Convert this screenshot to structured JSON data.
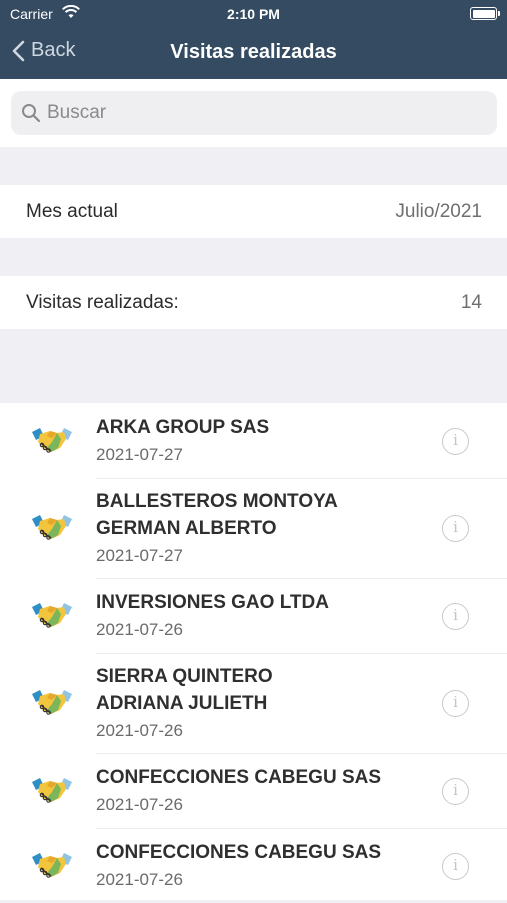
{
  "status_bar": {
    "carrier": "Carrier",
    "time": "2:10 PM"
  },
  "nav": {
    "back_label": "Back",
    "title": "Visitas realizadas"
  },
  "search": {
    "placeholder": "Buscar"
  },
  "summary": [
    {
      "label": "Mes actual",
      "value": "Julio/2021"
    },
    {
      "label": "Visitas realizadas:",
      "value": "14"
    }
  ],
  "visits": [
    {
      "name_lines": [
        "ARKA GROUP SAS"
      ],
      "date": "2021-07-27"
    },
    {
      "name_lines": [
        "BALLESTEROS MONTOYA",
        "GERMAN ALBERTO"
      ],
      "date": "2021-07-27"
    },
    {
      "name_lines": [
        "INVERSIONES GAO LTDA"
      ],
      "date": "2021-07-26"
    },
    {
      "name_lines": [
        "SIERRA QUINTERO",
        "ADRIANA JULIETH"
      ],
      "date": "2021-07-26"
    },
    {
      "name_lines": [
        "CONFECCIONES CABEGU SAS"
      ],
      "date": "2021-07-26"
    },
    {
      "name_lines": [
        "CONFECCIONES CABEGU SAS"
      ],
      "date": "2021-07-26"
    }
  ],
  "icons": {
    "visit": "handshake-icon",
    "detail": "info-icon",
    "back": "chevron-left-icon",
    "search": "search-icon"
  },
  "colors": {
    "nav_bar": "#344b61",
    "background": "#efeff4"
  }
}
